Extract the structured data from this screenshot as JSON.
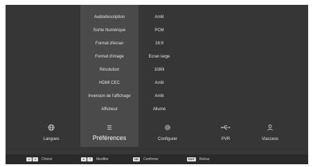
{
  "settings": [
    {
      "label": "Audiodescription",
      "value": "Arrêt"
    },
    {
      "label": "Sortie Numérique",
      "value": "PCM"
    },
    {
      "label": "Format d'écran",
      "value": "16:9"
    },
    {
      "label": "Format d'image",
      "value": "Ecran large"
    },
    {
      "label": "Résolution",
      "value": "1080i"
    },
    {
      "label": "HDMI CEC",
      "value": "Arrêt"
    },
    {
      "label": "Inversion de l'affichage",
      "value": "Arrêt"
    },
    {
      "label": "Afficheur",
      "value": "Allumé"
    }
  ],
  "menu": [
    {
      "label": "Langues",
      "icon": "globe-icon"
    },
    {
      "label": "Préférences",
      "icon": "list-icon",
      "active": true
    },
    {
      "label": "Configurer",
      "icon": "gear-icon"
    },
    {
      "label": "PVR",
      "icon": "usb-icon"
    },
    {
      "label": "Viaccess",
      "icon": "user-icon"
    }
  ],
  "footer": {
    "choose": {
      "keys": [
        "<",
        ">"
      ],
      "label": "Choisir"
    },
    "modify": {
      "keys": [
        "v",
        "^"
      ],
      "label": "Modifier"
    },
    "confirm": {
      "keys": [
        "OK"
      ],
      "label": "Confirmer"
    },
    "back": {
      "keys": [
        "EXIT"
      ],
      "label": "Retour"
    }
  },
  "colors": {
    "background": "#363636",
    "highlight": "#4a4a4a",
    "footer": "#2a2a2a",
    "text": "#e6e6e6"
  }
}
